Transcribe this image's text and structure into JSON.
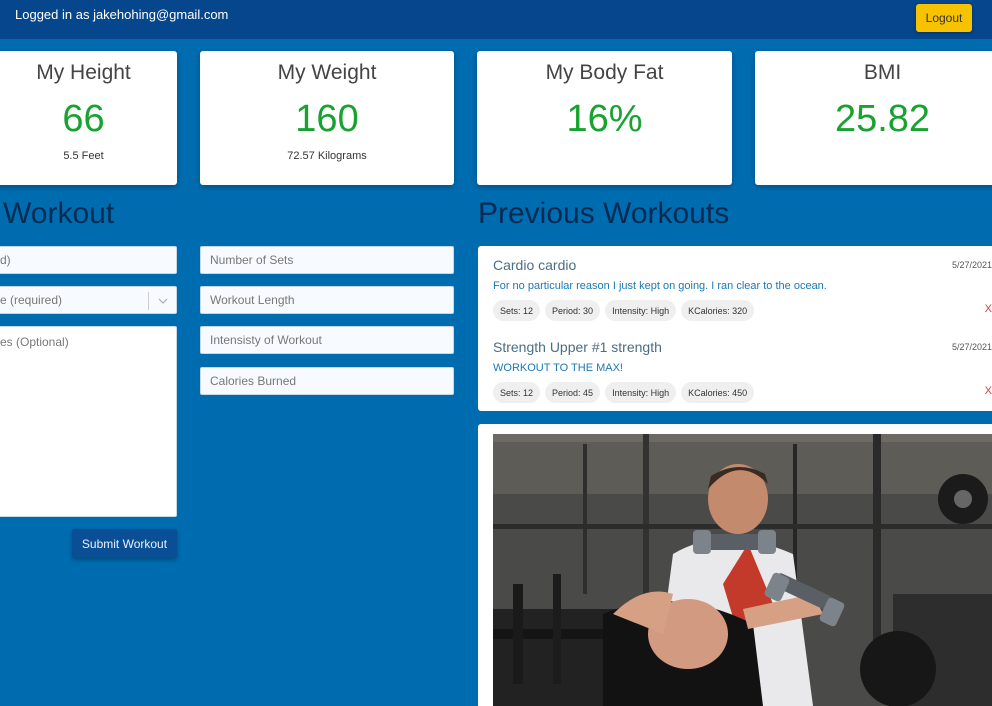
{
  "header": {
    "login_text": "Logged in as jakehohing@gmail.com",
    "logout_label": "Logout"
  },
  "stats": {
    "height": {
      "title": "My Height",
      "value": "66",
      "sub": "5.5 Feet"
    },
    "weight": {
      "title": "My Weight",
      "value": "160",
      "sub": "72.57 Kilograms"
    },
    "bodyfat": {
      "title": "My Body Fat",
      "value": "16%"
    },
    "bmi": {
      "title": "BMI",
      "value": "25.82"
    }
  },
  "add_workout": {
    "title": "Workout",
    "name_placeholder": "d)",
    "type_placeholder": "e (required)",
    "notes_placeholder": "es (Optional)",
    "sets_placeholder": "Number of Sets",
    "length_placeholder": "Workout Length",
    "intensity_placeholder": "Intensisty of Workout",
    "calories_placeholder": "Calories Burned",
    "submit_label": "Submit Workout"
  },
  "previous": {
    "title": "Previous Workouts",
    "workouts": [
      {
        "title": "Cardio cardio",
        "date": "5/27/2021",
        "description": "For no particular reason I just kept on going. I ran clear to the ocean.",
        "chips": [
          "Sets: 12",
          "Period: 30",
          "Intensity: High",
          "KCalories: 320"
        ],
        "delete": "X"
      },
      {
        "title": "Strength Upper #1 strength",
        "date": "5/27/2021",
        "description": "WORKOUT TO THE MAX!",
        "chips": [
          "Sets: 12",
          "Period: 45",
          "Intensity: High",
          "KCalories: 450"
        ],
        "delete": "X"
      }
    ]
  },
  "colors": {
    "background": "#006cb0",
    "header": "#06468c",
    "accent_green": "#18a230",
    "logout_yellow": "#f7c200"
  }
}
